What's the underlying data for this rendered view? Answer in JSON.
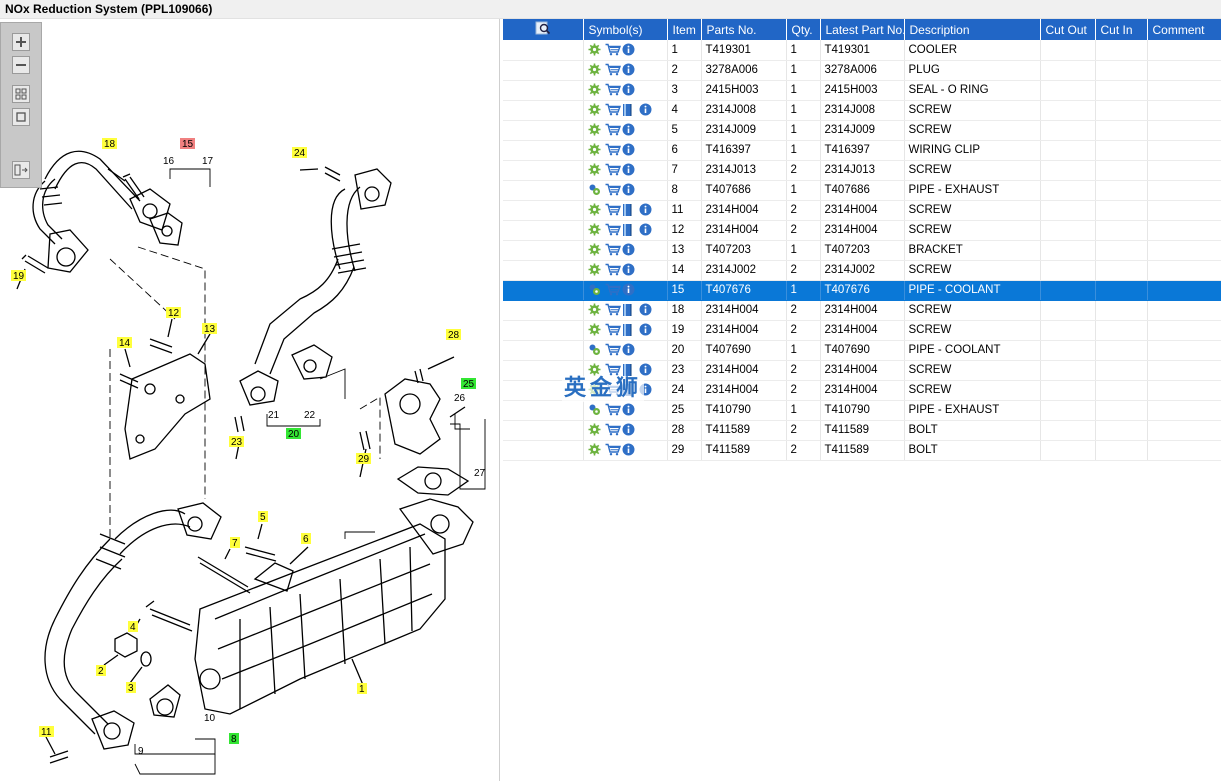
{
  "window": {
    "title": "NOx Reduction System (PPL109066)"
  },
  "colors": {
    "header_bg": "#2166c6",
    "selected_row_bg": "#0a78d7",
    "callout_yellow": "#ffff3c",
    "callout_green": "#33e633",
    "callout_red": "#f08080"
  },
  "toolbar": {
    "zoom_in": "plus-icon",
    "zoom_out": "minus-icon",
    "fit_all": "fit-grid-icon",
    "zoom_box": "zoom-box-icon",
    "split_view": "split-view-icon"
  },
  "diagram": {
    "callouts": [
      {
        "label": "1",
        "color": "yellow"
      },
      {
        "label": "2",
        "color": "yellow"
      },
      {
        "label": "3",
        "color": "yellow"
      },
      {
        "label": "4",
        "color": "yellow"
      },
      {
        "label": "5",
        "color": "yellow"
      },
      {
        "label": "6",
        "color": "yellow"
      },
      {
        "label": "7",
        "color": "yellow"
      },
      {
        "label": "8",
        "color": "green"
      },
      {
        "label": "11",
        "color": "yellow"
      },
      {
        "label": "12",
        "color": "yellow"
      },
      {
        "label": "13",
        "color": "yellow"
      },
      {
        "label": "14",
        "color": "yellow"
      },
      {
        "label": "15",
        "color": "red"
      },
      {
        "label": "18",
        "color": "yellow"
      },
      {
        "label": "19",
        "color": "yellow"
      },
      {
        "label": "20",
        "color": "green"
      },
      {
        "label": "23",
        "color": "yellow"
      },
      {
        "label": "24",
        "color": "yellow"
      },
      {
        "label": "25",
        "color": "green"
      },
      {
        "label": "28",
        "color": "yellow"
      },
      {
        "label": "29",
        "color": "yellow"
      }
    ],
    "reference_numbers": [
      "16",
      "17",
      "21",
      "22",
      "26",
      "27",
      "9",
      "10"
    ]
  },
  "table": {
    "header_icon": "search-list-icon",
    "columns": [
      "Symbol(s)",
      "Item",
      "Parts No.",
      "Qty.",
      "Latest Part No.",
      "Description",
      "Cut Out",
      "Cut In",
      "Comment"
    ],
    "rows": [
      {
        "item": "1",
        "part_no": "T419301",
        "qty": "1",
        "latest": "T419301",
        "desc": "COOLER",
        "book": false,
        "multi": false
      },
      {
        "item": "2",
        "part_no": "3278A006",
        "qty": "1",
        "latest": "3278A006",
        "desc": "PLUG",
        "book": false,
        "multi": false
      },
      {
        "item": "3",
        "part_no": "2415H003",
        "qty": "1",
        "latest": "2415H003",
        "desc": "SEAL - O RING",
        "book": false,
        "multi": false
      },
      {
        "item": "4",
        "part_no": "2314J008",
        "qty": "1",
        "latest": "2314J008",
        "desc": "SCREW",
        "book": true,
        "multi": false
      },
      {
        "item": "5",
        "part_no": "2314J009",
        "qty": "1",
        "latest": "2314J009",
        "desc": "SCREW",
        "book": false,
        "multi": false
      },
      {
        "item": "6",
        "part_no": "T416397",
        "qty": "1",
        "latest": "T416397",
        "desc": "WIRING CLIP",
        "book": false,
        "multi": false
      },
      {
        "item": "7",
        "part_no": "2314J013",
        "qty": "2",
        "latest": "2314J013",
        "desc": "SCREW",
        "book": false,
        "multi": false
      },
      {
        "item": "8",
        "part_no": "T407686",
        "qty": "1",
        "latest": "T407686",
        "desc": "PIPE - EXHAUST",
        "book": false,
        "multi": true
      },
      {
        "item": "11",
        "part_no": "2314H004",
        "qty": "2",
        "latest": "2314H004",
        "desc": "SCREW",
        "book": true,
        "multi": false
      },
      {
        "item": "12",
        "part_no": "2314H004",
        "qty": "2",
        "latest": "2314H004",
        "desc": "SCREW",
        "book": true,
        "multi": false
      },
      {
        "item": "13",
        "part_no": "T407203",
        "qty": "1",
        "latest": "T407203",
        "desc": "BRACKET",
        "book": false,
        "multi": false
      },
      {
        "item": "14",
        "part_no": "2314J002",
        "qty": "2",
        "latest": "2314J002",
        "desc": "SCREW",
        "book": false,
        "multi": false
      },
      {
        "item": "15",
        "part_no": "T407676",
        "qty": "1",
        "latest": "T407676",
        "desc": "PIPE - COOLANT",
        "book": false,
        "multi": true,
        "selected": true
      },
      {
        "item": "18",
        "part_no": "2314H004",
        "qty": "2",
        "latest": "2314H004",
        "desc": "SCREW",
        "book": true,
        "multi": false
      },
      {
        "item": "19",
        "part_no": "2314H004",
        "qty": "2",
        "latest": "2314H004",
        "desc": "SCREW",
        "book": true,
        "multi": false
      },
      {
        "item": "20",
        "part_no": "T407690",
        "qty": "1",
        "latest": "T407690",
        "desc": "PIPE - COOLANT",
        "book": false,
        "multi": true
      },
      {
        "item": "23",
        "part_no": "2314H004",
        "qty": "2",
        "latest": "2314H004",
        "desc": "SCREW",
        "book": true,
        "multi": false
      },
      {
        "item": "24",
        "part_no": "2314H004",
        "qty": "2",
        "latest": "2314H004",
        "desc": "SCREW",
        "book": true,
        "multi": false
      },
      {
        "item": "25",
        "part_no": "T410790",
        "qty": "1",
        "latest": "T410790",
        "desc": "PIPE - EXHAUST",
        "book": false,
        "multi": true
      },
      {
        "item": "28",
        "part_no": "T411589",
        "qty": "2",
        "latest": "T411589",
        "desc": "BOLT",
        "book": false,
        "multi": false
      },
      {
        "item": "29",
        "part_no": "T411589",
        "qty": "2",
        "latest": "T411589",
        "desc": "BOLT",
        "book": false,
        "multi": false
      }
    ]
  },
  "watermark": {
    "text": "英金狮"
  }
}
